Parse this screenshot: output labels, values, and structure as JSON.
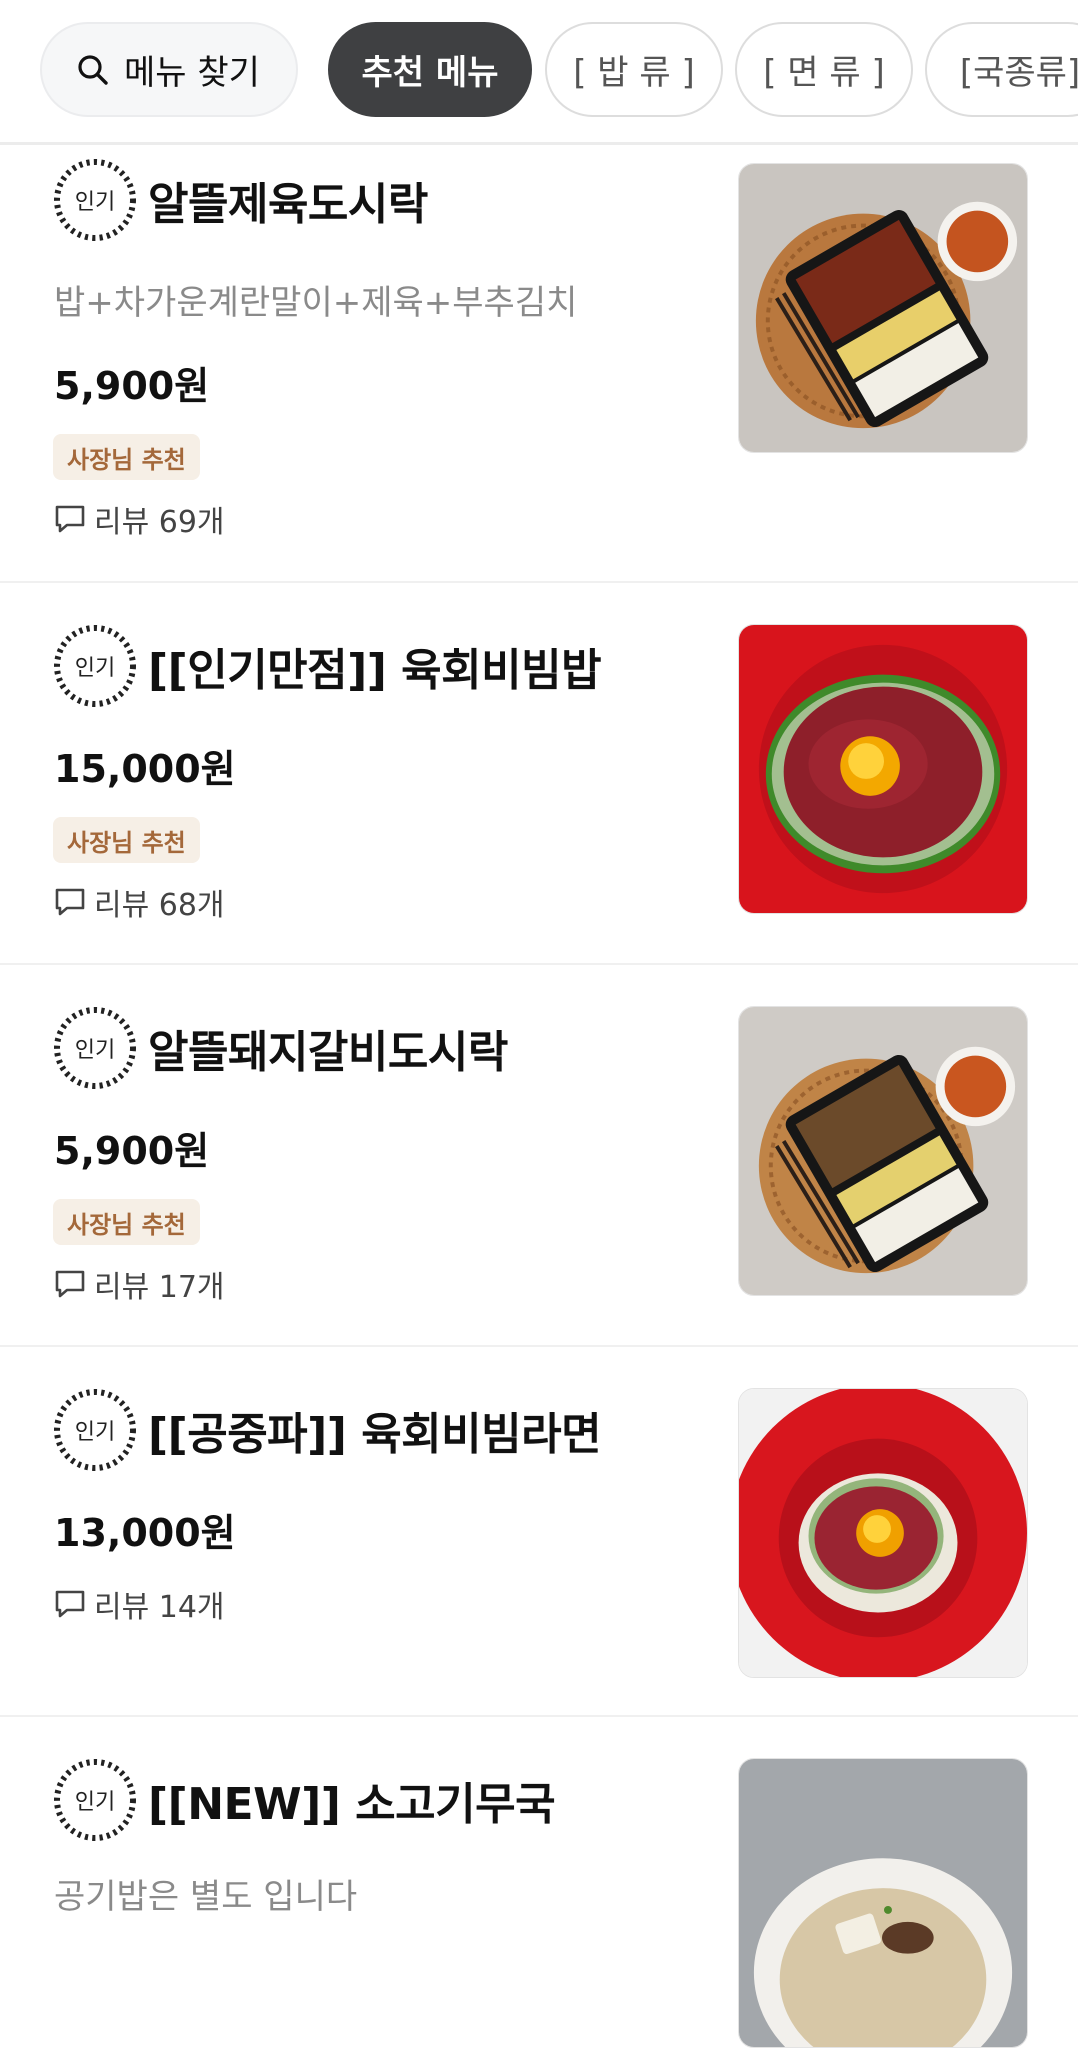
{
  "header": {
    "search_label": "메뉴 찾기",
    "search_icon": "search-icon",
    "tabs": [
      {
        "label": "추천 메뉴",
        "active": true
      },
      {
        "label": "[ 밥 류 ]",
        "active": false
      },
      {
        "label": "[ 면 류 ]",
        "active": false
      },
      {
        "label": "[국종류]",
        "active": false
      }
    ]
  },
  "badge_text": "인기",
  "menu": [
    {
      "title": "알뜰제육도시락",
      "description": "밥+차가운계란말이+제육+부추김치",
      "price": "5,900원",
      "recommend": "사장님 추천",
      "reviews": "리뷰 69개",
      "photo": "jeyuk-lunchbox"
    },
    {
      "title": "[[인기만점]] 육회비빔밥",
      "price": "15,000원",
      "recommend": "사장님 추천",
      "reviews": "리뷰 68개",
      "photo": "yukhoe-bibimbap"
    },
    {
      "title": "알뜰돼지갈비도시락",
      "price": "5,900원",
      "recommend": "사장님 추천",
      "reviews": "리뷰 17개",
      "photo": "galbi-lunchbox"
    },
    {
      "title": "[[공중파]] 육회비빔라면",
      "price": "13,000원",
      "reviews": "리뷰 14개",
      "photo": "yukhoe-ramyeon"
    },
    {
      "title": "[[NEW]]  소고기무국",
      "description": "공기밥은  별도 입니다",
      "photo": "beef-radish-soup"
    }
  ],
  "colors": {
    "active_chip": "#3f4042",
    "recommend_bg": "#f6efe6",
    "recommend_text": "#a4683a"
  }
}
